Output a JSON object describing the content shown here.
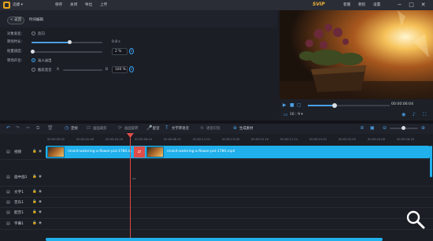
{
  "app": {
    "brand": "迅捷",
    "menu": [
      "保存",
      "关闭",
      "导出",
      "上传"
    ],
    "svip": "SVIP",
    "top_actions": [
      "客服",
      "教程",
      "设置"
    ],
    "win_buttons": [
      "minimize-icon",
      "maximize-icon",
      "close-icon"
    ]
  },
  "editor": {
    "back_label": "返回",
    "tab_label": "时间编辑"
  },
  "props": {
    "reverse_label": "对象渐变：",
    "reverse_option": "反向",
    "duration_label": "转场时长：",
    "duration_value": "0.8 s",
    "duration_fraction": 0.54,
    "speed_label": "批量速度：",
    "speed_value": "2 %",
    "speed_fraction": 0.02,
    "audio_label": "转场声音：",
    "audio_option": "淡入淡出",
    "crossfade_option": "截段混音",
    "range_a": "A",
    "range_b": "B",
    "range_value": "100 %"
  },
  "player": {
    "time": "00:00:06:04",
    "ratio": "16 : 9",
    "progress": 0.33
  },
  "toolbar": {
    "undo": "undo-icon",
    "items": [
      "定帧",
      "画面裁剪",
      "画面旋转",
      "配音",
      "文字转语音",
      "语音识别",
      "生成素材"
    ]
  },
  "ruler": {
    "ticks": [
      "00:00:00.00",
      "00:00:02.08",
      "00:00:04.16",
      "00:00:06.24",
      "00:00:08.32",
      "00:00:11.00",
      "00:00:13.08",
      "00:00:15.16",
      "00:00:17.24",
      "00:00:19.32",
      "00:00:22.00",
      "00:00:24.08",
      "00:00:26.16"
    ]
  },
  "tracks": [
    {
      "name": "视频",
      "icon": "video-track-icon"
    },
    {
      "name": "画中画1",
      "icon": "pip-track-icon"
    },
    {
      "name": "文字1",
      "icon": "text-track-icon"
    },
    {
      "name": "音乐1",
      "icon": "music-track-icon"
    },
    {
      "name": "配音1",
      "icon": "voice-track-icon"
    },
    {
      "name": "字幕1",
      "icon": "subtitle-track-icon"
    }
  ],
  "clips": [
    {
      "label": "mixkit-watering-a-flower-pot-1780.m"
    },
    {
      "label": "mixkit-watering-a-flower-pot-1780.mp4"
    }
  ],
  "colors": {
    "accent": "#20b0ec",
    "playhead": "#e04c48",
    "svip": "#f0b43a"
  }
}
